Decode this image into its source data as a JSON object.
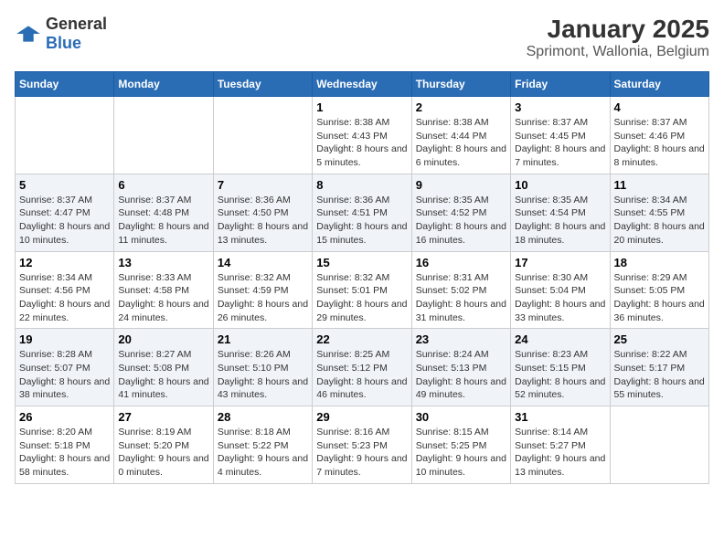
{
  "logo": {
    "general": "General",
    "blue": "Blue"
  },
  "title": "January 2025",
  "subtitle": "Sprimont, Wallonia, Belgium",
  "days_of_week": [
    "Sunday",
    "Monday",
    "Tuesday",
    "Wednesday",
    "Thursday",
    "Friday",
    "Saturday"
  ],
  "weeks": [
    [
      {
        "day": "",
        "info": ""
      },
      {
        "day": "",
        "info": ""
      },
      {
        "day": "",
        "info": ""
      },
      {
        "day": "1",
        "info": "Sunrise: 8:38 AM\nSunset: 4:43 PM\nDaylight: 8 hours and 5 minutes."
      },
      {
        "day": "2",
        "info": "Sunrise: 8:38 AM\nSunset: 4:44 PM\nDaylight: 8 hours and 6 minutes."
      },
      {
        "day": "3",
        "info": "Sunrise: 8:37 AM\nSunset: 4:45 PM\nDaylight: 8 hours and 7 minutes."
      },
      {
        "day": "4",
        "info": "Sunrise: 8:37 AM\nSunset: 4:46 PM\nDaylight: 8 hours and 8 minutes."
      }
    ],
    [
      {
        "day": "5",
        "info": "Sunrise: 8:37 AM\nSunset: 4:47 PM\nDaylight: 8 hours and 10 minutes."
      },
      {
        "day": "6",
        "info": "Sunrise: 8:37 AM\nSunset: 4:48 PM\nDaylight: 8 hours and 11 minutes."
      },
      {
        "day": "7",
        "info": "Sunrise: 8:36 AM\nSunset: 4:50 PM\nDaylight: 8 hours and 13 minutes."
      },
      {
        "day": "8",
        "info": "Sunrise: 8:36 AM\nSunset: 4:51 PM\nDaylight: 8 hours and 15 minutes."
      },
      {
        "day": "9",
        "info": "Sunrise: 8:35 AM\nSunset: 4:52 PM\nDaylight: 8 hours and 16 minutes."
      },
      {
        "day": "10",
        "info": "Sunrise: 8:35 AM\nSunset: 4:54 PM\nDaylight: 8 hours and 18 minutes."
      },
      {
        "day": "11",
        "info": "Sunrise: 8:34 AM\nSunset: 4:55 PM\nDaylight: 8 hours and 20 minutes."
      }
    ],
    [
      {
        "day": "12",
        "info": "Sunrise: 8:34 AM\nSunset: 4:56 PM\nDaylight: 8 hours and 22 minutes."
      },
      {
        "day": "13",
        "info": "Sunrise: 8:33 AM\nSunset: 4:58 PM\nDaylight: 8 hours and 24 minutes."
      },
      {
        "day": "14",
        "info": "Sunrise: 8:32 AM\nSunset: 4:59 PM\nDaylight: 8 hours and 26 minutes."
      },
      {
        "day": "15",
        "info": "Sunrise: 8:32 AM\nSunset: 5:01 PM\nDaylight: 8 hours and 29 minutes."
      },
      {
        "day": "16",
        "info": "Sunrise: 8:31 AM\nSunset: 5:02 PM\nDaylight: 8 hours and 31 minutes."
      },
      {
        "day": "17",
        "info": "Sunrise: 8:30 AM\nSunset: 5:04 PM\nDaylight: 8 hours and 33 minutes."
      },
      {
        "day": "18",
        "info": "Sunrise: 8:29 AM\nSunset: 5:05 PM\nDaylight: 8 hours and 36 minutes."
      }
    ],
    [
      {
        "day": "19",
        "info": "Sunrise: 8:28 AM\nSunset: 5:07 PM\nDaylight: 8 hours and 38 minutes."
      },
      {
        "day": "20",
        "info": "Sunrise: 8:27 AM\nSunset: 5:08 PM\nDaylight: 8 hours and 41 minutes."
      },
      {
        "day": "21",
        "info": "Sunrise: 8:26 AM\nSunset: 5:10 PM\nDaylight: 8 hours and 43 minutes."
      },
      {
        "day": "22",
        "info": "Sunrise: 8:25 AM\nSunset: 5:12 PM\nDaylight: 8 hours and 46 minutes."
      },
      {
        "day": "23",
        "info": "Sunrise: 8:24 AM\nSunset: 5:13 PM\nDaylight: 8 hours and 49 minutes."
      },
      {
        "day": "24",
        "info": "Sunrise: 8:23 AM\nSunset: 5:15 PM\nDaylight: 8 hours and 52 minutes."
      },
      {
        "day": "25",
        "info": "Sunrise: 8:22 AM\nSunset: 5:17 PM\nDaylight: 8 hours and 55 minutes."
      }
    ],
    [
      {
        "day": "26",
        "info": "Sunrise: 8:20 AM\nSunset: 5:18 PM\nDaylight: 8 hours and 58 minutes."
      },
      {
        "day": "27",
        "info": "Sunrise: 8:19 AM\nSunset: 5:20 PM\nDaylight: 9 hours and 0 minutes."
      },
      {
        "day": "28",
        "info": "Sunrise: 8:18 AM\nSunset: 5:22 PM\nDaylight: 9 hours and 4 minutes."
      },
      {
        "day": "29",
        "info": "Sunrise: 8:16 AM\nSunset: 5:23 PM\nDaylight: 9 hours and 7 minutes."
      },
      {
        "day": "30",
        "info": "Sunrise: 8:15 AM\nSunset: 5:25 PM\nDaylight: 9 hours and 10 minutes."
      },
      {
        "day": "31",
        "info": "Sunrise: 8:14 AM\nSunset: 5:27 PM\nDaylight: 9 hours and 13 minutes."
      },
      {
        "day": "",
        "info": ""
      }
    ]
  ]
}
